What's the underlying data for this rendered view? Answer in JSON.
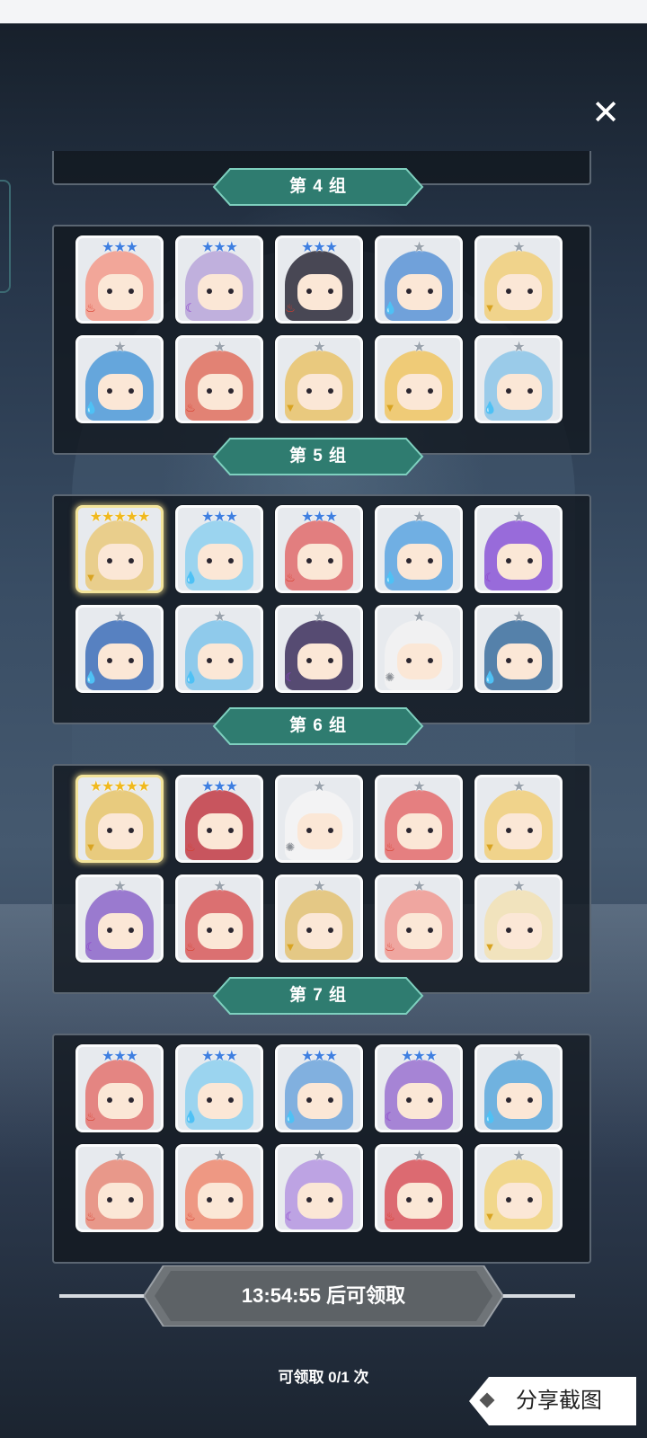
{
  "close_label": "✕",
  "groups": [
    {
      "title": "第 4 组",
      "cards": [
        {
          "stars": "★★★",
          "star_color": "blue",
          "element": "fire",
          "hair": "#f39a8a"
        },
        {
          "stars": "★★★",
          "star_color": "blue",
          "element": "dark",
          "hair": "#b9a6d9"
        },
        {
          "stars": "★★★",
          "star_color": "blue",
          "element": "fire",
          "hair": "#2c2a38"
        },
        {
          "stars": "★",
          "star_color": "silver",
          "element": "water",
          "hair": "#5a94d6"
        },
        {
          "stars": "★",
          "star_color": "silver",
          "element": "earth",
          "hair": "#f1cf79"
        },
        {
          "stars": "★",
          "star_color": "silver",
          "element": "water",
          "hair": "#4e9ad8"
        },
        {
          "stars": "★",
          "star_color": "silver",
          "element": "fire",
          "hair": "#e0705e"
        },
        {
          "stars": "★",
          "star_color": "silver",
          "element": "earth",
          "hair": "#e9c36a"
        },
        {
          "stars": "★",
          "star_color": "silver",
          "element": "earth",
          "hair": "#f0c562"
        },
        {
          "stars": "★",
          "star_color": "silver",
          "element": "water",
          "hair": "#8cc6e8"
        }
      ]
    },
    {
      "title": "第 5 组",
      "cards": [
        {
          "stars": "★★★★★",
          "star_color": "gold",
          "element": "earth",
          "hair": "#e9c97a",
          "gold": true
        },
        {
          "stars": "★★★",
          "star_color": "blue",
          "element": "water",
          "hair": "#8dd0ee"
        },
        {
          "stars": "★★★",
          "star_color": "blue",
          "element": "fire",
          "hair": "#e06b6b"
        },
        {
          "stars": "★",
          "star_color": "silver",
          "element": "water",
          "hair": "#5aa4e0"
        },
        {
          "stars": "★",
          "star_color": "silver",
          "element": "dark",
          "hair": "#8a55d6"
        },
        {
          "stars": "★",
          "star_color": "silver",
          "element": "water",
          "hair": "#3d6fb8"
        },
        {
          "stars": "★",
          "star_color": "silver",
          "element": "water",
          "hair": "#7fc4ea"
        },
        {
          "stars": "★",
          "star_color": "silver",
          "element": "dark",
          "hair": "#3c2f5c"
        },
        {
          "stars": "★",
          "star_color": "silver",
          "element": "light",
          "hair": "#f2f2f2"
        },
        {
          "stars": "★",
          "star_color": "silver",
          "element": "water",
          "hair": "#3b6e9e"
        }
      ]
    },
    {
      "title": "第 6 组",
      "cards": [
        {
          "stars": "★★★★★",
          "star_color": "gold",
          "element": "earth",
          "hair": "#e7c56a",
          "gold": true
        },
        {
          "stars": "★★★",
          "star_color": "blue",
          "element": "fire",
          "hair": "#c23b44"
        },
        {
          "stars": "★",
          "star_color": "silver",
          "element": "light",
          "hair": "#f4f4f4"
        },
        {
          "stars": "★",
          "star_color": "silver",
          "element": "fire",
          "hair": "#e46c6c"
        },
        {
          "stars": "★",
          "star_color": "silver",
          "element": "earth",
          "hair": "#f1cf79"
        },
        {
          "stars": "★",
          "star_color": "silver",
          "element": "dark",
          "hair": "#8c66c9"
        },
        {
          "stars": "★",
          "star_color": "silver",
          "element": "fire",
          "hair": "#d85a5a"
        },
        {
          "stars": "★",
          "star_color": "silver",
          "element": "earth",
          "hair": "#e3c272"
        },
        {
          "stars": "★",
          "star_color": "silver",
          "element": "fire",
          "hair": "#f09a92"
        },
        {
          "stars": "★",
          "star_color": "silver",
          "element": "earth",
          "hair": "#f2e2b4"
        }
      ]
    },
    {
      "title": "第 7 组",
      "cards": [
        {
          "stars": "★★★",
          "star_color": "blue",
          "element": "fire",
          "hair": "#e3736e"
        },
        {
          "stars": "★★★",
          "star_color": "blue",
          "element": "water",
          "hair": "#8dd0ee"
        },
        {
          "stars": "★★★",
          "star_color": "blue",
          "element": "water",
          "hair": "#6fa6dc"
        },
        {
          "stars": "★★★",
          "star_color": "blue",
          "element": "dark",
          "hair": "#9a72d0"
        },
        {
          "stars": "★",
          "star_color": "silver",
          "element": "water",
          "hair": "#5aa8dc"
        },
        {
          "stars": "★",
          "star_color": "silver",
          "element": "fire",
          "hair": "#e88a78"
        },
        {
          "stars": "★",
          "star_color": "silver",
          "element": "fire",
          "hair": "#ee8a70"
        },
        {
          "stars": "★",
          "star_color": "silver",
          "element": "dark",
          "hair": "#b596e0"
        },
        {
          "stars": "★",
          "star_color": "silver",
          "element": "fire",
          "hair": "#d9535a"
        },
        {
          "stars": "★",
          "star_color": "silver",
          "element": "earth",
          "hair": "#f2d37a"
        }
      ]
    }
  ],
  "element_icons": {
    "fire": {
      "glyph": "♨",
      "color": "#d83b2b"
    },
    "water": {
      "glyph": "💧",
      "color": "#2a7fd4"
    },
    "dark": {
      "glyph": "☾",
      "color": "#8b3fc9"
    },
    "earth": {
      "glyph": "▼",
      "color": "#d9a422"
    },
    "light": {
      "glyph": "✺",
      "color": "#8a8f96"
    }
  },
  "claim": {
    "label": "13:54:55 后可领取",
    "count_text": "可领取 0/1 次"
  },
  "share": {
    "label": "分享截图"
  }
}
